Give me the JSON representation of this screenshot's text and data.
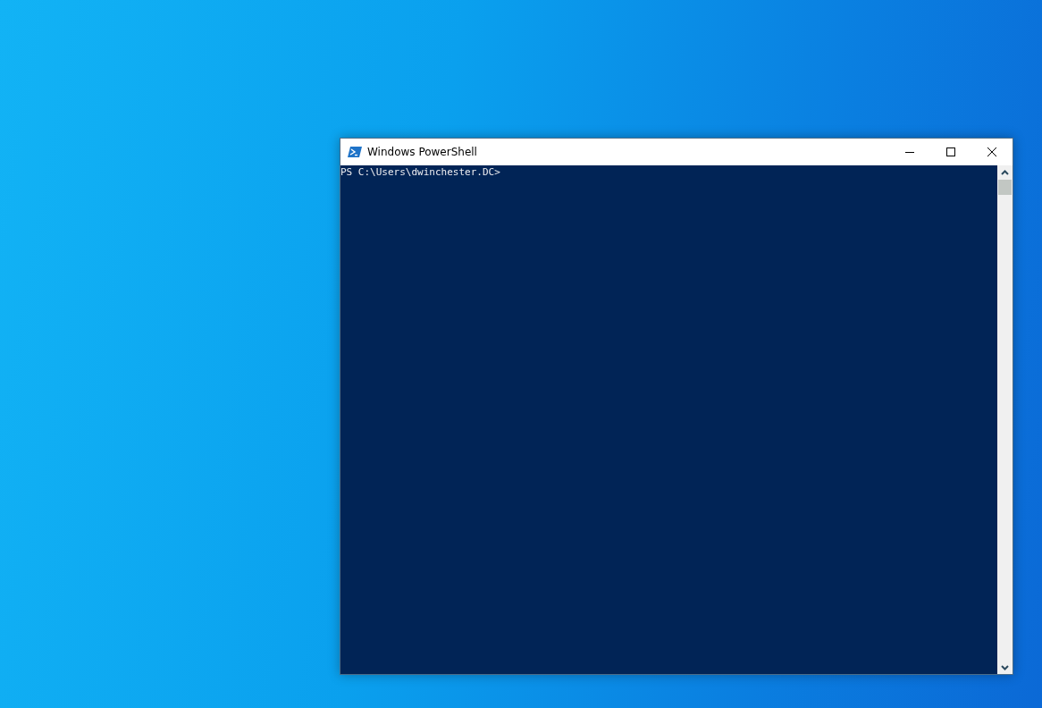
{
  "window": {
    "title": "Windows PowerShell"
  },
  "console": {
    "lines": [
      "PS C:\\Users\\dwinchester.DC>"
    ]
  }
}
